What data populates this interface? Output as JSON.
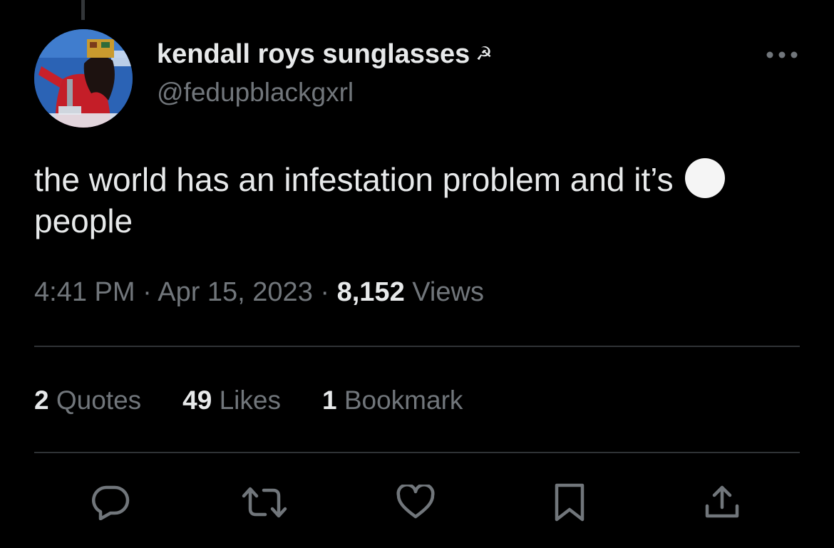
{
  "user": {
    "display_name": "kendall roys sunglasses",
    "name_emoji": "☭",
    "handle": "@fedupblackgxrl"
  },
  "tweet": {
    "text_line1": "the world has an infestation problem and it’s",
    "text_line2": "people",
    "emoji": "white-circle"
  },
  "meta": {
    "time": "4:41 PM",
    "separator": "·",
    "date": "Apr 15, 2023",
    "views_count": "8,152",
    "views_label": "Views"
  },
  "stats": [
    {
      "count": "2",
      "label": "Quotes"
    },
    {
      "count": "49",
      "label": "Likes"
    },
    {
      "count": "1",
      "label": "Bookmark"
    }
  ],
  "actions": {
    "reply": "reply-icon",
    "retweet": "retweet-icon",
    "like": "heart-icon",
    "bookmark": "bookmark-icon",
    "share": "share-icon"
  },
  "colors": {
    "background": "#000000",
    "primary_text": "#e7e9ea",
    "secondary_text": "#71767b",
    "divider": "#2f3336"
  }
}
